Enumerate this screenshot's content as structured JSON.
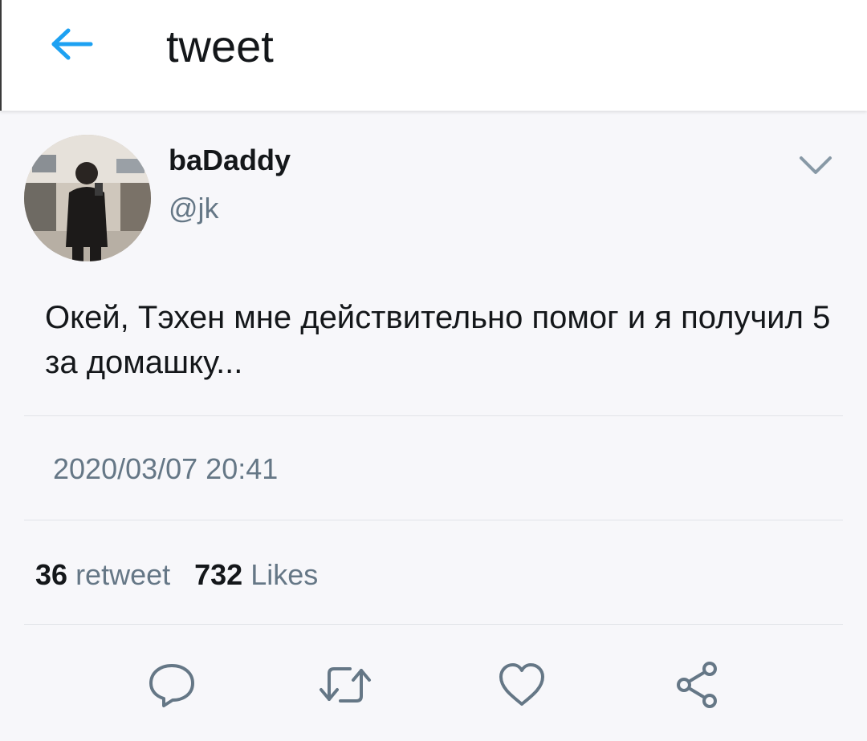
{
  "header": {
    "back_icon": "arrow-left-icon",
    "title": "tweet",
    "accent_color": "#1da1f2"
  },
  "tweet": {
    "display_name": "baDaddy",
    "handle": "@jk",
    "text": "Окей, Тэхен мне действительно помог и я получил 5 за домашку...",
    "timestamp": "2020/03/07 20:41"
  },
  "stats": {
    "retweets_count": "36",
    "retweets_label": "retweet",
    "likes_count": "732",
    "likes_label": "Likes"
  },
  "actions": [
    {
      "icon": "reply-icon"
    },
    {
      "icon": "retweet-icon"
    },
    {
      "icon": "like-icon"
    },
    {
      "icon": "share-icon"
    }
  ]
}
